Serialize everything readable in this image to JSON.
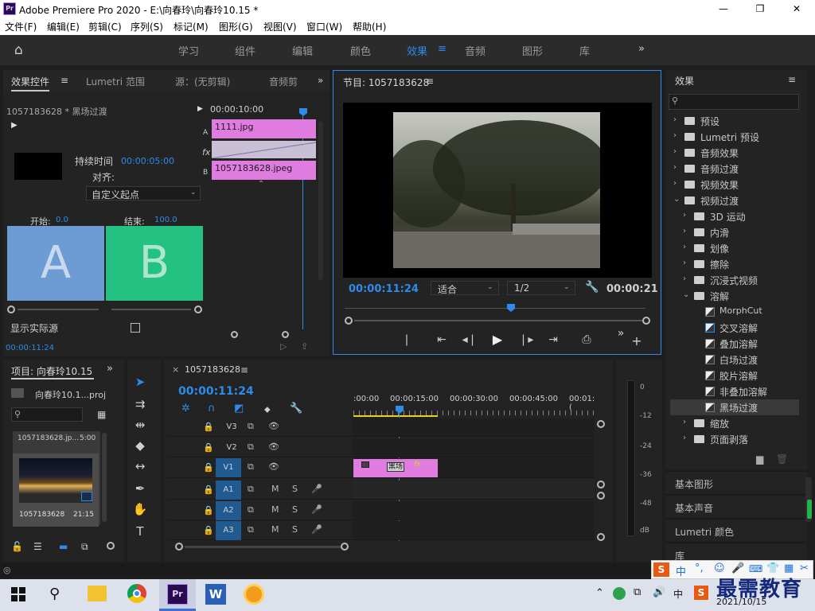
{
  "window": {
    "title": "Adobe Premiere Pro 2020 - E:\\向春玲\\向春玲10.15 *",
    "app_icon": "Pr",
    "controls": [
      "—",
      "❐",
      "✕"
    ]
  },
  "menu": [
    "文件(F)",
    "编辑(E)",
    "剪辑(C)",
    "序列(S)",
    "标记(M)",
    "图形(G)",
    "视图(V)",
    "窗口(W)",
    "帮助(H)"
  ],
  "workspaces": [
    "学习",
    "组件",
    "编辑",
    "颜色",
    "效果",
    "音频",
    "图形",
    "库"
  ],
  "effect_controls": {
    "tabs": [
      "效果控件",
      "Lumetri 范围",
      "源：(无剪辑)",
      "音频剪"
    ],
    "clip_label": "1057183628 * 黑场过渡",
    "timecode_ruler": "00:00:10:00",
    "duration_label": "持续时间",
    "duration_value": "00:00:05:00",
    "align_label": "对齐:",
    "align_value": "自定义起点",
    "track_a": "A",
    "track_b": "B",
    "clip_a_name": "1111.jpg",
    "clip_b_name": "1057183628.jpeg",
    "fx": "fx",
    "start_label": "开始:",
    "start_value": "0.0",
    "end_label": "结束:",
    "end_value": "100.0",
    "box_a": "A",
    "box_b": "B",
    "show_actual_label": "显示实际源",
    "footer_time": "00:00:11:24"
  },
  "program": {
    "title": "节目: 1057183628",
    "time_current": "00:00:11:24",
    "fit_value": "适合",
    "res_value": "1/2",
    "duration": "00:00:21"
  },
  "effects": {
    "title": "效果",
    "rows": [
      {
        "label": "预设",
        "level": 0,
        "open": false,
        "type": "folder"
      },
      {
        "label": "Lumetri 预设",
        "level": 0,
        "open": false,
        "type": "folder"
      },
      {
        "label": "音频效果",
        "level": 0,
        "open": false,
        "type": "folder"
      },
      {
        "label": "音频过渡",
        "level": 0,
        "open": false,
        "type": "folder"
      },
      {
        "label": "视频效果",
        "level": 0,
        "open": false,
        "type": "folder"
      },
      {
        "label": "视频过渡",
        "level": 0,
        "open": true,
        "type": "folder"
      },
      {
        "label": "3D 运动",
        "level": 1,
        "open": false,
        "type": "folder"
      },
      {
        "label": "内滑",
        "level": 1,
        "open": false,
        "type": "folder"
      },
      {
        "label": "划像",
        "level": 1,
        "open": false,
        "type": "folder"
      },
      {
        "label": "擦除",
        "level": 1,
        "open": false,
        "type": "folder"
      },
      {
        "label": "沉浸式视频",
        "level": 1,
        "open": false,
        "type": "folder"
      },
      {
        "label": "溶解",
        "level": 1,
        "open": true,
        "type": "folder"
      },
      {
        "label": "MorphCut",
        "level": 2,
        "type": "item"
      },
      {
        "label": "交叉溶解",
        "level": 2,
        "type": "item"
      },
      {
        "label": "叠加溶解",
        "level": 2,
        "type": "item"
      },
      {
        "label": "白场过渡",
        "level": 2,
        "type": "item"
      },
      {
        "label": "胶片溶解",
        "level": 2,
        "type": "item"
      },
      {
        "label": "非叠加溶解",
        "level": 2,
        "type": "item"
      },
      {
        "label": "黑场过渡",
        "level": 2,
        "type": "item",
        "selected": true
      },
      {
        "label": "缩放",
        "level": 1,
        "open": false,
        "type": "folder"
      },
      {
        "label": "页面剥落",
        "level": 1,
        "open": false,
        "type": "folder"
      }
    ],
    "sections": [
      "基本图形",
      "基本声音",
      "Lumetri 颜色",
      "库"
    ]
  },
  "project": {
    "title": "项目: 向春玲10.15",
    "file": "向春玲10.1...proj",
    "item_name": "1057183628.jp...",
    "item_dur": "5:00",
    "item_label": "1057183628",
    "item_dur2": "21:15"
  },
  "timeline": {
    "title": "1057183628",
    "timecode": "00:00:11:24",
    "ruler": [
      ":00:00",
      "00:00:15:00",
      "00:00:30:00",
      "00:00:45:00",
      "00:01:("
    ],
    "tracks": [
      "V3",
      "V2",
      "V1",
      "A1",
      "A2",
      "A3"
    ],
    "mute": "M",
    "solo": "S",
    "clip_label": "黑场"
  },
  "meter": {
    "labels": [
      "0",
      "-12",
      "-24",
      "-36",
      "-48",
      "dB"
    ]
  },
  "taskbar": {
    "date": "2021/10/15",
    "ime": "中",
    "watermark": "最需教育"
  }
}
